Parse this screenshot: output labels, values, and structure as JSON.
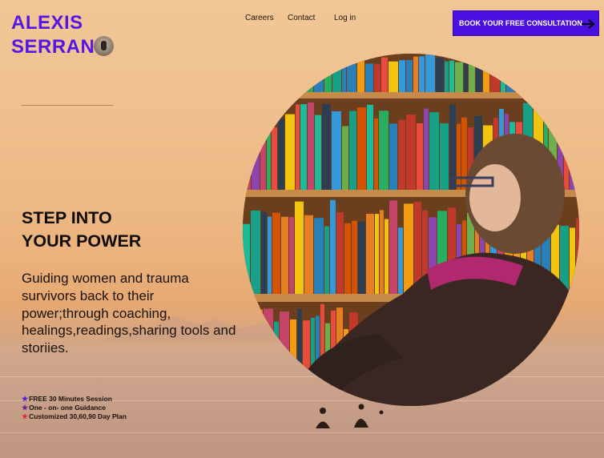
{
  "brand": {
    "line1": "ALEXIS",
    "line2": "SERRAN",
    "accent": "#5516e6"
  },
  "nav": {
    "careers": "Careers",
    "contact": "Contact",
    "login": "Log in"
  },
  "cta": {
    "label": "BOOK YOUR FREE CONSULTATION",
    "color": "#4a10e0",
    "icon": "arrow-right-icon"
  },
  "hero": {
    "headline_line1": "STEP INTO",
    "headline_line2": "YOUR POWER",
    "subtitle": "Guiding women and trauma survivors back to their power;through coaching, healings,readings,sharing tools and storiies."
  },
  "features": [
    {
      "icon": "star-icon",
      "color": "#5516e6",
      "text": "FREE 30 Minutes  Session"
    },
    {
      "icon": "star-icon",
      "color": "#6a1a9a",
      "text": "One - on- one Guidance"
    },
    {
      "icon": "star-icon",
      "color": "#d8322a",
      "text": "Customized 30,60,90 Day Plan"
    }
  ],
  "image": {
    "subject": "library-photo"
  }
}
